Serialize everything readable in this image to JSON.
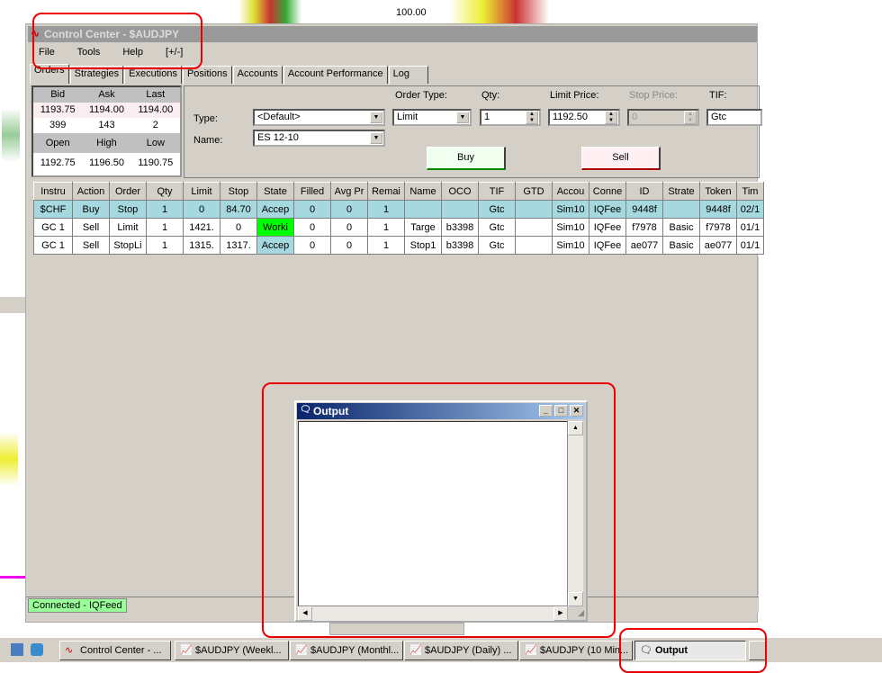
{
  "window": {
    "title": "Control Center - $AUDJPY"
  },
  "menu": [
    "File",
    "Tools",
    "Help",
    "[+/-]"
  ],
  "tabs": [
    "Orders",
    "Strategies",
    "Executions",
    "Positions",
    "Accounts",
    "Account Performance",
    "Log"
  ],
  "background": {
    "price_label": "100.00"
  },
  "quote": {
    "headers1": [
      "Bid",
      "Ask",
      "Last"
    ],
    "prices": [
      "1193.75",
      "1194.00",
      "1194.00"
    ],
    "sizes": [
      "399",
      "143",
      "2"
    ],
    "headers2": [
      "Open",
      "High",
      "Low"
    ],
    "ohl": [
      "1192.75",
      "1196.50",
      "1190.75"
    ]
  },
  "order_entry": {
    "type_label": "Type:",
    "type_value": "<Default>",
    "name_label": "Name:",
    "name_value": "ES 12-10",
    "order_type_label": "Order Type:",
    "order_type_value": "Limit",
    "qty_label": "Qty:",
    "qty_value": "1",
    "limit_label": "Limit Price:",
    "limit_value": "1192.50",
    "stop_label": "Stop Price:",
    "stop_value": "0",
    "tif_label": "TIF:",
    "tif_value": "Gtc",
    "buy": "Buy",
    "sell": "Sell"
  },
  "orders": {
    "columns": [
      "Instru",
      "Action",
      "Order",
      "Qty",
      "Limit",
      "Stop",
      "State",
      "Filled",
      "Avg Pr",
      "Remai",
      "Name",
      "OCO",
      "TIF",
      "GTD",
      "Accou",
      "Conne",
      "ID",
      "Strate",
      "Token",
      "Tim"
    ],
    "rows": [
      [
        "$CHF",
        "Buy",
        "Stop",
        "1",
        "0",
        "84.70",
        "Accep",
        "0",
        "0",
        "1",
        "",
        "",
        "Gtc",
        "",
        "Sim10",
        "IQFee",
        "9448f",
        "",
        "9448f",
        "02/1"
      ],
      [
        "GC 1",
        "Sell",
        "Limit",
        "1",
        "1421.",
        "0",
        "Worki",
        "0",
        "0",
        "1",
        "Targe",
        "b3398",
        "Gtc",
        "",
        "Sim10",
        "IQFee",
        "f7978",
        "Basic",
        "f7978",
        "01/1"
      ],
      [
        "GC 1",
        "Sell",
        "StopLi",
        "1",
        "1315.",
        "1317.",
        "Accep",
        "0",
        "0",
        "1",
        "Stop1",
        "b3398",
        "Gtc",
        "",
        "Sim10",
        "IQFee",
        "ae077",
        "Basic",
        "ae077",
        "01/1"
      ]
    ]
  },
  "status": "Connected - IQFeed",
  "output_window": {
    "title": "Output",
    "content": ""
  },
  "taskbar": [
    "Control Center - ...",
    "$AUDJPY (Weekl...",
    "$AUDJPY (Monthl...",
    "$AUDJPY (Daily) ...",
    "$AUDJPY (10 Min...",
    "Output"
  ],
  "colors": {
    "working": "#00ff00",
    "accepted": "#a6d8e0",
    "annotation": "#ee0000"
  }
}
